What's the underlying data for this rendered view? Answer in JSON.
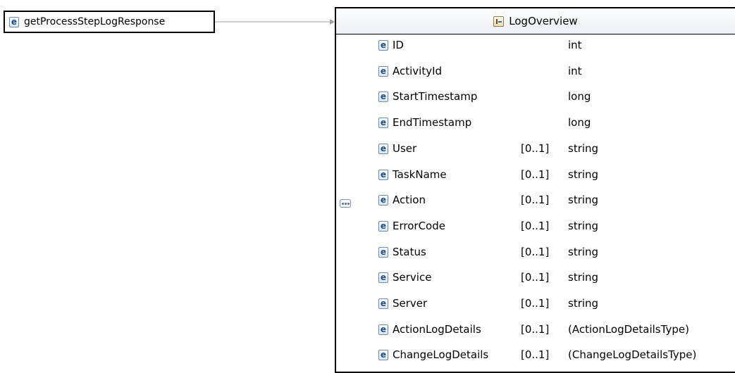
{
  "root_element": {
    "badge": "e",
    "name": "getProcessStepLogResponse"
  },
  "complex_type": {
    "title": "LogOverview",
    "icon": "complex-type-icon"
  },
  "compositor": {
    "icon": "sequence-icon"
  },
  "elements": [
    {
      "badge": "e",
      "name": "ID",
      "cardinality": "",
      "type": "int"
    },
    {
      "badge": "e",
      "name": "ActivityId",
      "cardinality": "",
      "type": "int"
    },
    {
      "badge": "e",
      "name": "StartTimestamp",
      "cardinality": "",
      "type": "long"
    },
    {
      "badge": "e",
      "name": "EndTimestamp",
      "cardinality": "",
      "type": "long"
    },
    {
      "badge": "e",
      "name": "User",
      "cardinality": "[0..1]",
      "type": "string"
    },
    {
      "badge": "e",
      "name": "TaskName",
      "cardinality": "[0..1]",
      "type": "string"
    },
    {
      "badge": "e",
      "name": "Action",
      "cardinality": "[0..1]",
      "type": "string"
    },
    {
      "badge": "e",
      "name": "ErrorCode",
      "cardinality": "[0..1]",
      "type": "string"
    },
    {
      "badge": "e",
      "name": "Status",
      "cardinality": "[0..1]",
      "type": "string"
    },
    {
      "badge": "e",
      "name": "Service",
      "cardinality": "[0..1]",
      "type": "string"
    },
    {
      "badge": "e",
      "name": "Server",
      "cardinality": "[0..1]",
      "type": "string"
    },
    {
      "badge": "e",
      "name": "ActionLogDetails",
      "cardinality": "[0..1]",
      "type": "(ActionLogDetailsType)"
    },
    {
      "badge": "e",
      "name": "ChangeLogDetails",
      "cardinality": "[0..1]",
      "type": "(ChangeLogDetailsType)"
    }
  ],
  "colors": {
    "badge_border": "#6d8cb3",
    "badge_text": "#1e4d8c",
    "connector": "#8c8c8c"
  }
}
